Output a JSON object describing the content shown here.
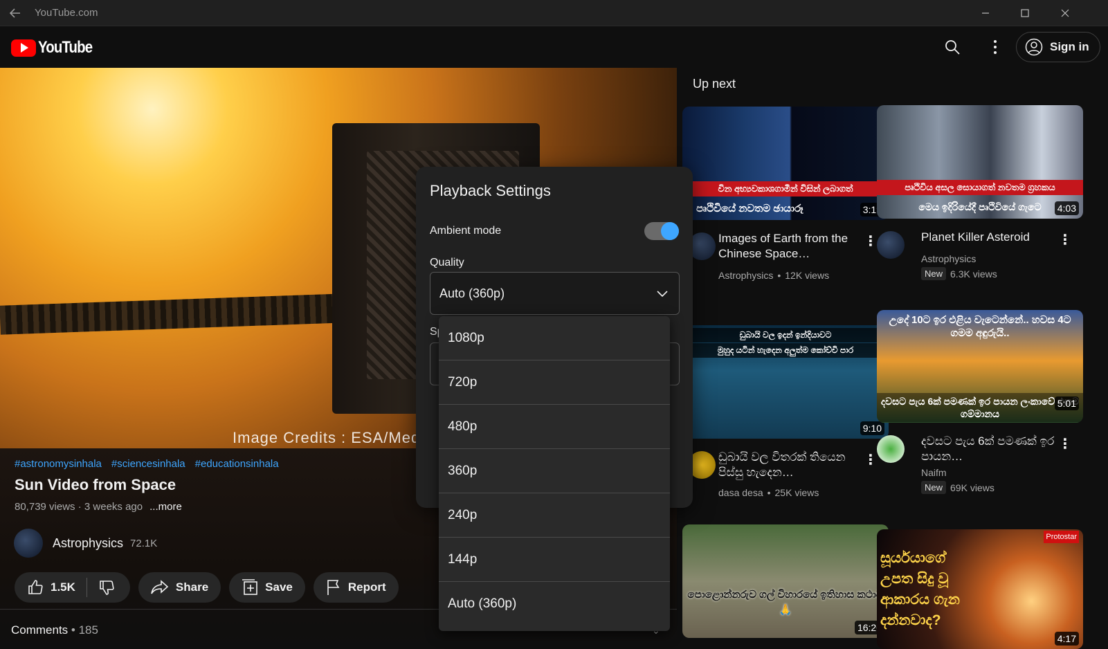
{
  "window": {
    "title": "YouTube.com"
  },
  "header": {
    "logo_text": "YouTube",
    "signin_label": "Sign in"
  },
  "video": {
    "credit": "Image Credits : ESA/Medi",
    "tags": [
      "#astronomysinhala",
      "#sciencesinhala",
      "#educationsinhala"
    ],
    "title": "Sun Video from Space",
    "meta": "80,739 views · 3 weeks ago",
    "more_label": "...more",
    "channel": {
      "name": "Astrophysics",
      "subscribers": "72.1K"
    },
    "actions": {
      "likes": "1.5K",
      "share": "Share",
      "save": "Save",
      "report": "Report"
    },
    "comments": {
      "label": "Comments",
      "count": " • 185"
    }
  },
  "sidebar": {
    "heading": "Up next",
    "cards": [
      {
        "duration": "3:19",
        "title": "Images of Earth from the Chinese Space…",
        "channel": "Astrophysics",
        "views": "12K views",
        "is_new": false,
        "thumb_text_top": "වින අභ්‍යවකාශගාමීන් විසින් ලබාගත්",
        "thumb_text_bottom": "පෘථිවියේ නවතම ඡායාරූ"
      },
      {
        "duration": "4:03",
        "title": "Planet Killer Asteroid",
        "channel": "Astrophysics",
        "views": "6.3K views",
        "is_new": true,
        "new_label": "New",
        "thumb_text_top": "පෘථිවිය අසල සොයාගත් නවතම ග්‍රහකය",
        "thumb_text_bottom": "මෙය ඉදිරියේදී පෘථිවියේ ගැටෙ"
      },
      {
        "duration": "9:10",
        "title": "ඩුබායි වල විතරක් තියෙන පිස්සු හැදෙන…",
        "channel": "dasa desa",
        "views": "25K views",
        "is_new": false,
        "thumb_text_top": "ඩුබායි වල ඉදන් ඉන්දියාවට",
        "thumb_text_bottom": "මුහුද යටින් හැදෙන අලුත්ම කෝච්චි පාර"
      },
      {
        "duration": "5:01",
        "title": "දවසට පැය 6ක් පමණක් ඉර පායන…",
        "channel": "Naifm",
        "views": "69K views",
        "is_new": true,
        "new_label": "New",
        "thumb_text_top": "උදේ 10ට ඉර එළිය වැටෙන්නේ.. හවස 4ට ගමම අඳුරුයි..",
        "thumb_text_bottom": "දවසට පැය 6ක් පමණක් ඉර පායන ලංකාවේ එකම ගම්මානය"
      },
      {
        "duration": "16:20",
        "title": "",
        "thumb_text_top": "පොළොන්නරුව ගල් විහාරයේ ඉතිහාස කථාව 🙏",
        "thumb_text_bottom": ""
      },
      {
        "duration": "4:17",
        "title": "",
        "thumb_text_top": "සූර්යයාගේ උපත සිදු වූ ආකාරය ගැන දන්නවාද?",
        "thumb_text_bottom": "Protostar"
      }
    ]
  },
  "playback_settings": {
    "title": "Playback Settings",
    "ambient_label": "Ambient mode",
    "ambient_on": true,
    "quality_label": "Quality",
    "quality_value": "Auto (360p)",
    "speed_label_partial": "Sp",
    "quality_options": [
      "1080p",
      "720p",
      "480p",
      "360p",
      "240p",
      "144p",
      "Auto (360p)"
    ]
  },
  "colors": {
    "accent": "#3ea6ff",
    "brand": "#ff0000",
    "background": "#0f0f0f",
    "popup": "#212121"
  }
}
